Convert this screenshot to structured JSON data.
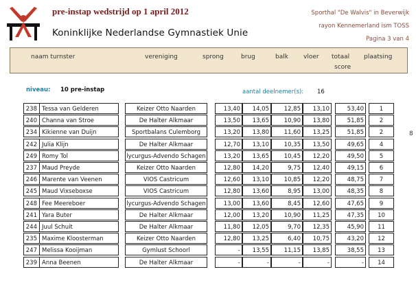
{
  "header": {
    "title": "pre-instap wedstrijd op 1 april 2012",
    "organization": "Koninklijke Nederlandse Gymnastiek Unie",
    "venue": "Sporthal \"De Walvis\" in Beverwijk",
    "region": "rayon Kennemerland ism TOSS",
    "page": "Pagina 3 van 4"
  },
  "columns": {
    "naam": "naam turnster",
    "vereniging": "vereniging",
    "sprong": "sprong",
    "brug": "brug",
    "balk": "balk",
    "vloer": "vloer",
    "totaal1": "totaal",
    "totaal2": "score",
    "plaatsing": "plaatsing"
  },
  "group": {
    "niveau_label": "niveau:",
    "niveau_value": "10 pre-instap",
    "aantal_label": "aantal deelnemer(s):",
    "aantal_value": "16"
  },
  "stray_mark": "8",
  "rows": [
    {
      "nr": "238",
      "naam": "Tessa van Gelderen",
      "vereniging": "Keizer Otto Naarden",
      "sprong": "13,40",
      "brug": "14,05",
      "balk": "12,85",
      "vloer": "13,10",
      "totaal": "53,40",
      "plaats": "1"
    },
    {
      "nr": "240",
      "naam": "Channa van Stroe",
      "vereniging": "De Halter Alkmaar",
      "sprong": "13,50",
      "brug": "13,65",
      "balk": "10,90",
      "vloer": "13,80",
      "totaal": "51,85",
      "plaats": "2"
    },
    {
      "nr": "234",
      "naam": "Kikienne van Duijn",
      "vereniging": "Sportbalans Culemborg",
      "sprong": "13,20",
      "brug": "13,80",
      "balk": "11,60",
      "vloer": "13,25",
      "totaal": "51,85",
      "plaats": "2"
    },
    {
      "nr": "242",
      "naam": "Julia Klijn",
      "vereniging": "De Halter Alkmaar",
      "sprong": "12,70",
      "brug": "13,10",
      "balk": "10,35",
      "vloer": "13,50",
      "totaal": "49,65",
      "plaats": "4"
    },
    {
      "nr": "249",
      "naam": "Romy Tol",
      "vereniging": "lycurgus-Advendo Schagen",
      "sprong": "13,20",
      "brug": "13,65",
      "balk": "10,45",
      "vloer": "12,20",
      "totaal": "49,50",
      "plaats": "5"
    },
    {
      "nr": "237",
      "naam": "Maud Preyde",
      "vereniging": "Keizer Otto Naarden",
      "sprong": "12,80",
      "brug": "14,20",
      "balk": "9,75",
      "vloer": "12,40",
      "totaal": "49,15",
      "plaats": "6"
    },
    {
      "nr": "246",
      "naam": "Marente van Veenen",
      "vereniging": "VIOS Castricum",
      "sprong": "12,60",
      "brug": "13,10",
      "balk": "10,85",
      "vloer": "12,20",
      "totaal": "48,75",
      "plaats": "7"
    },
    {
      "nr": "245",
      "naam": "Maud Vixseboxse",
      "vereniging": "VIOS Castricum",
      "sprong": "12,80",
      "brug": "13,60",
      "balk": "8,95",
      "vloer": "13,00",
      "totaal": "48,35",
      "plaats": "8"
    },
    {
      "nr": "248",
      "naam": "Fee Meereboer",
      "vereniging": "lycurgus-Advendo Schagen",
      "sprong": "13,00",
      "brug": "13,60",
      "balk": "8,45",
      "vloer": "12,60",
      "totaal": "47,65",
      "plaats": "9"
    },
    {
      "nr": "241",
      "naam": "Yara Buter",
      "vereniging": "De Halter Alkmaar",
      "sprong": "12,00",
      "brug": "13,20",
      "balk": "10,90",
      "vloer": "11,25",
      "totaal": "47,35",
      "plaats": "10"
    },
    {
      "nr": "244",
      "naam": "Juul Schuit",
      "vereniging": "De Halter Alkmaar",
      "sprong": "11,80",
      "brug": "12,05",
      "balk": "9,70",
      "vloer": "12,35",
      "totaal": "45,90",
      "plaats": "11"
    },
    {
      "nr": "235",
      "naam": "Maxime Kloosterman",
      "vereniging": "Keizer Otto Naarden",
      "sprong": "12,80",
      "brug": "13,25",
      "balk": "6,40",
      "vloer": "10,75",
      "totaal": "43,20",
      "plaats": "12"
    },
    {
      "nr": "247",
      "naam": "Melissa Kooijman",
      "vereniging": "Gymlust Schoorl",
      "sprong": "-",
      "brug": "13,55",
      "balk": "11,15",
      "vloer": "13,85",
      "totaal": "38,55",
      "plaats": "13"
    },
    {
      "nr": "239",
      "naam": "Anna Beenen",
      "vereniging": "De Halter Alkmaar",
      "sprong": "-",
      "brug": "-",
      "balk": "-",
      "vloer": "-",
      "totaal": "-",
      "plaats": "14"
    }
  ]
}
